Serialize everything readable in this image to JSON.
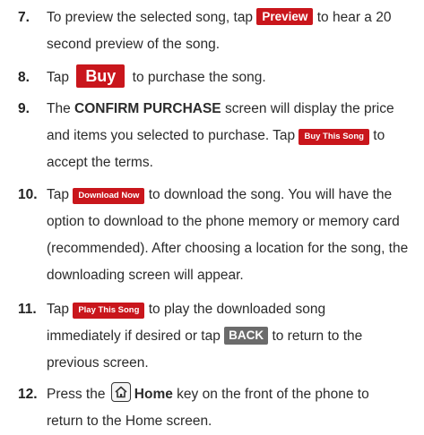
{
  "steps": [
    {
      "num": "7.",
      "pre": "To preview the selected song, tap ",
      "button": "Preview",
      "post_line1": " to hear a 20",
      "line2": "second preview of the song."
    },
    {
      "num": "8.",
      "pre": "Tap ",
      "button": "Buy",
      "post": " to purchase the song."
    },
    {
      "num": "9.",
      "pre": "The ",
      "bold": "CONFIRM PURCHASE",
      "post_line1": " screen will display the price",
      "line2_pre": "and items you selected to purchase. Tap ",
      "button": "Buy This Song",
      "line2_post": " to",
      "line3": "accept the terms."
    },
    {
      "num": "10.",
      "pre": "Tap ",
      "button": "Download Now",
      "post_line1": " to download the song. You will have the",
      "line2": "option to download to the phone memory or memory card",
      "line3": "(recommended). After choosing a location for the song, the",
      "line4": "downloading screen will appear."
    },
    {
      "num": "11.",
      "pre": "Tap ",
      "button": "Play This Song",
      "post_line1": " to play the downloaded song",
      "line2_pre": "immediately if desired or tap ",
      "back_button": "BACK",
      "line2_post": " to return to the",
      "line3": "previous screen."
    },
    {
      "num": "12.",
      "pre": "Press the ",
      "bold": "Home",
      "post_line1": " key on the front of the phone to",
      "line2": "return to the Home screen."
    }
  ],
  "icons": {
    "home_key": "home-icon"
  },
  "colors": {
    "button_red": "#c9161c",
    "back_button_gray": "#6b6b6b"
  }
}
